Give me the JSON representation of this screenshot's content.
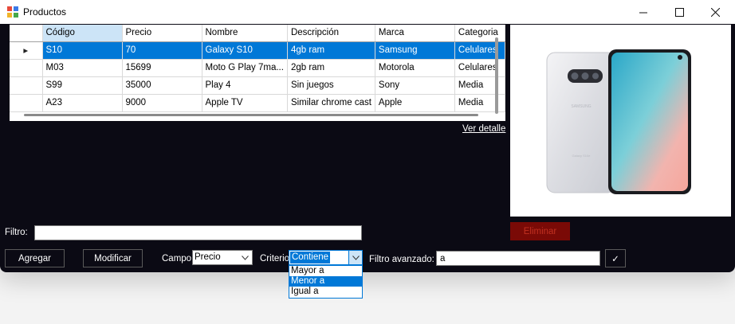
{
  "window": {
    "title": "Productos",
    "minimize_glyph": "—",
    "maximize_glyph": "☐",
    "close_glyph": "✕"
  },
  "grid": {
    "columns": [
      "Código",
      "Precio",
      "Nombre",
      "Descripción",
      "Marca",
      "Categoria"
    ],
    "selected_row": 0,
    "row_pointer_glyph": "▸",
    "rows": [
      [
        "S10",
        "70",
        "Galaxy S10",
        "4gb ram",
        "Samsung",
        "Celulares"
      ],
      [
        "M03",
        "15699",
        "Moto G Play 7ma...",
        "2gb ram",
        "Motorola",
        "Celulares"
      ],
      [
        "S99",
        "35000",
        "Play 4",
        "Sin juegos",
        "Sony",
        "Media"
      ],
      [
        "A23",
        "9000",
        "Apple TV",
        "Similar chrome cast",
        "Apple",
        "Media"
      ]
    ]
  },
  "ver_detalle": "Ver detalle",
  "image": {
    "brand_text": "SAMSUNG",
    "model_text": "Galaxy S10e"
  },
  "eliminar_label": "Eliminar",
  "filtro": {
    "label": "Filtro:",
    "value": ""
  },
  "buttons": {
    "agregar": "Agregar",
    "modificar": "Modificar",
    "check_glyph": "✓"
  },
  "campo": {
    "label": "Campo:",
    "value": "Precio"
  },
  "criterio": {
    "label": "Criterio:",
    "value": "Contiene",
    "options": [
      "Mayor a",
      "Menor a",
      "Igual a"
    ],
    "highlighted_option": 1
  },
  "filtro_avanzado": {
    "label": "Filtro avanzado:",
    "value": "a"
  },
  "colors": {
    "window_bg": "#0b0a14",
    "selection": "#0078d7",
    "eliminar_bg": "#7a0a06"
  }
}
